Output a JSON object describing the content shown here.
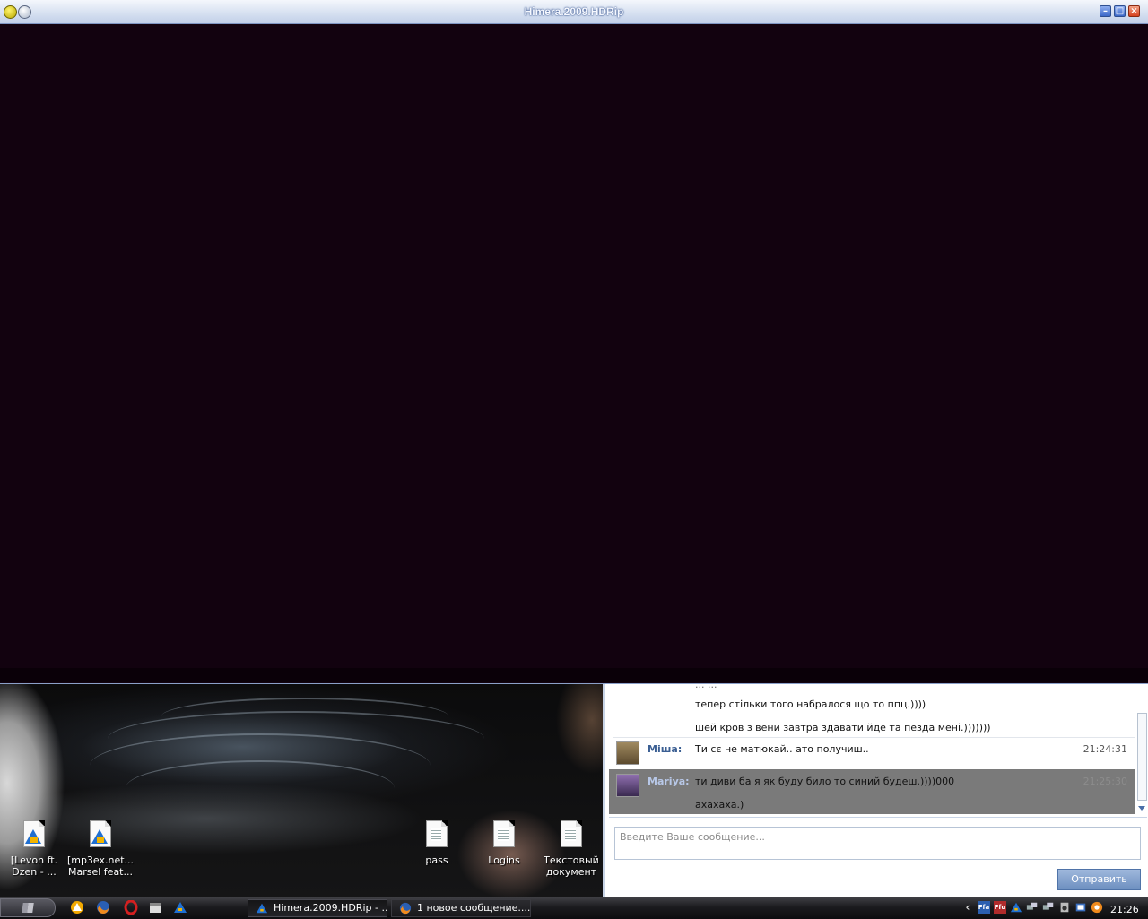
{
  "player": {
    "title": "Himera.2009.HDRip",
    "buttons": {
      "minimize": "–",
      "maximize": "□",
      "close": "×"
    }
  },
  "desktop": {
    "icons": [
      {
        "label": "[Levon ft.\nDzen - ...",
        "icon": "aimp-audio-file-icon"
      },
      {
        "label": "[mp3ex.net...\nMarsel feat...",
        "icon": "aimp-audio-file-icon"
      },
      {
        "label": "pass",
        "icon": "text-document-icon"
      },
      {
        "label": "Logins",
        "icon": "text-document-icon"
      },
      {
        "label": "Текстовый\nдокумент",
        "icon": "text-document-icon"
      }
    ]
  },
  "chat": {
    "cut_line": "... ...",
    "messages": [
      {
        "text": "тепер стільки того набралося що то ппц.))))"
      },
      {
        "text": "шей кров з вени завтра здавати йде та пезда мені.)))))))"
      },
      {
        "sender": "Міша:",
        "text": "Ти сє не матюкай.. ато получиш..",
        "time": "21:24:31"
      },
      {
        "sender": "Mariya:",
        "text": "ти диви ба я як буду било то синий будеш.))))000",
        "time": "21:25:30",
        "text2": "ахахаха.)"
      }
    ],
    "input_placeholder": "Введите Ваше сообщение...",
    "send_label": "Отправить"
  },
  "taskbar": {
    "tasks": [
      {
        "label": "Himera.2009.HDRip - ...",
        "icon": "aimp-icon",
        "active": true
      },
      {
        "label": "1 новое сообщение....",
        "icon": "firefox-icon",
        "active": false
      }
    ],
    "tray_labels": {
      "tray1": "Ffa",
      "tray2": "Ffu"
    },
    "clock": "21:26"
  },
  "colors": {
    "video_bg": "#12020f",
    "title_bar": "#c1cfe8",
    "highlight_row": "#7a7a7a",
    "send_button": "#6d8fc0"
  }
}
